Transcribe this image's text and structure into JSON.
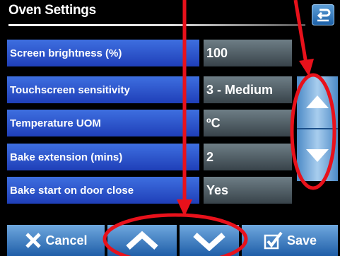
{
  "header": {
    "title": "Oven Settings"
  },
  "settings": [
    {
      "label": "Screen brightness (%)",
      "value": "100"
    },
    {
      "label": "Touchscreen sensitivity",
      "value": "3 - Medium"
    },
    {
      "label": "Temperature UOM",
      "value": "ºC"
    },
    {
      "label": "Bake extension (mins)",
      "value": "2"
    },
    {
      "label": "Bake start on door close",
      "value": "Yes"
    }
  ],
  "footer": {
    "cancel_label": "Cancel",
    "save_label": "Save"
  },
  "annotations": {
    "color": "#e8111b"
  },
  "icons": {
    "back": "back-arrow-icon",
    "scroll_up": "triangle-up-icon",
    "scroll_down": "triangle-down-icon",
    "cancel": "x-icon",
    "save": "checkbox-icon",
    "prev": "chevron-up-icon",
    "next": "chevron-down-icon"
  }
}
